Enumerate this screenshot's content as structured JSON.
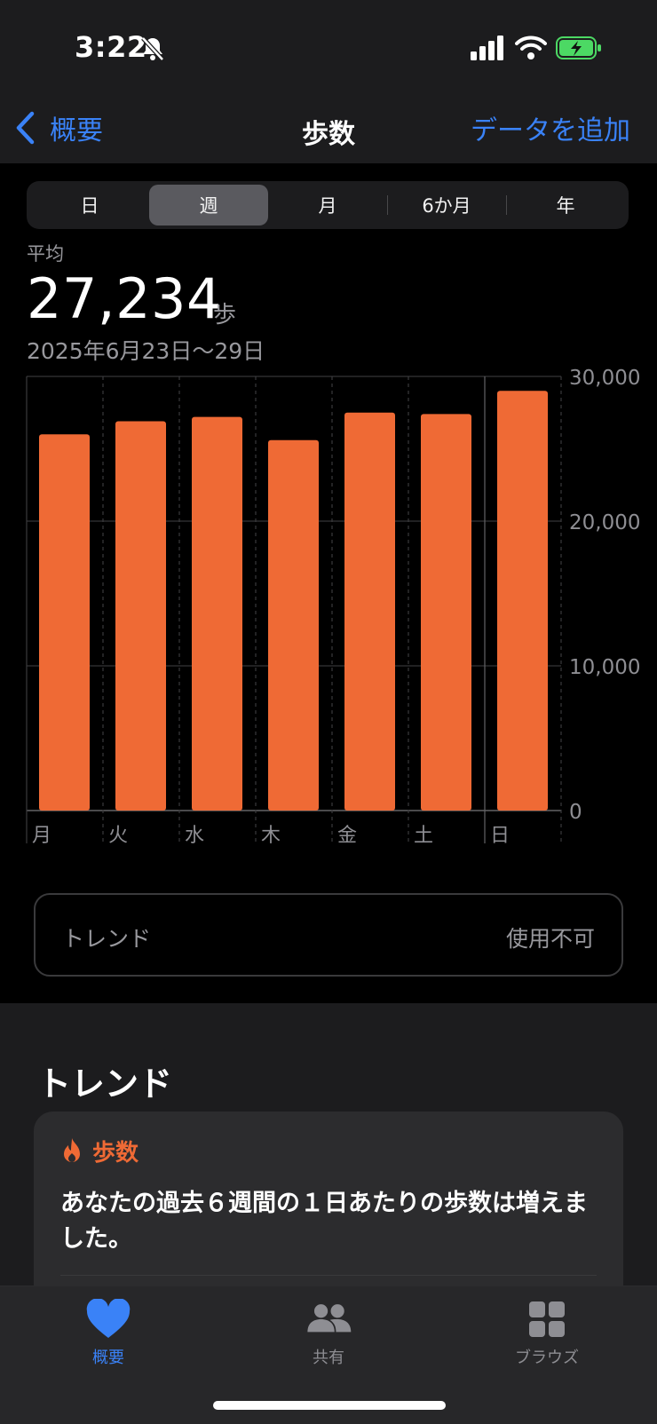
{
  "status_bar": {
    "time": "3:22",
    "icons": [
      "bell-slash-icon",
      "signal-icon",
      "wifi-icon",
      "battery-charging-icon"
    ]
  },
  "nav": {
    "back_label": "概要",
    "title": "歩数",
    "action_label": "データを追加"
  },
  "segments": [
    "日",
    "週",
    "月",
    "6か月",
    "年"
  ],
  "selected_segment": "週",
  "summary": {
    "label": "平均",
    "value": "27,234",
    "unit": "歩",
    "date_range": "2025年6月23日〜29日"
  },
  "chart_data": {
    "type": "bar",
    "categories": [
      "月",
      "火",
      "水",
      "木",
      "金",
      "土",
      "日"
    ],
    "values": [
      26000,
      26900,
      27200,
      25600,
      27500,
      27400,
      29000
    ],
    "y_ticks": [
      "30,000",
      "20,000",
      "10,000",
      "0"
    ],
    "ylim": [
      0,
      30000
    ],
    "grid": true,
    "color": "#ef6a35"
  },
  "trend_pill": {
    "label": "トレンド",
    "value": "使用不可"
  },
  "trends_section": {
    "title": "トレンド",
    "card": {
      "category": "歩数",
      "text": "あなたの過去６週間の１日あたりの歩数は増えました。"
    }
  },
  "tabbar": {
    "items": [
      {
        "label": "概要",
        "icon": "heart-icon",
        "active": true
      },
      {
        "label": "共有",
        "icon": "people-icon",
        "active": false
      },
      {
        "label": "ブラウズ",
        "icon": "grid-icon",
        "active": false
      }
    ]
  },
  "colors": {
    "accent": "#3a82f7",
    "bar": "#ef6a35"
  }
}
